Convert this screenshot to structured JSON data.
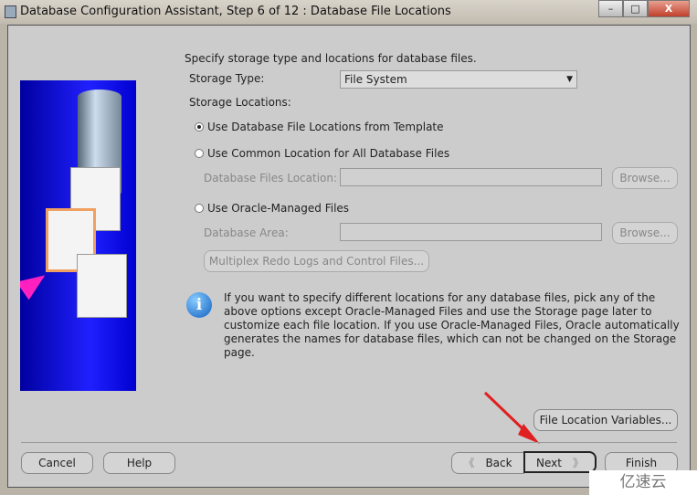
{
  "window": {
    "title": "Database Configuration Assistant, Step 6 of 12 : Database File Locations",
    "minimize": "–",
    "maximize": "□",
    "close": "X"
  },
  "intro": "Specify storage type and locations for database files.",
  "storage_type_label": "Storage Type:",
  "storage_type_value": "File System",
  "storage_locations_label": "Storage Locations:",
  "options": [
    {
      "label": "Use Database File Locations from Template",
      "selected": true
    },
    {
      "label": "Use Common Location for All Database Files",
      "selected": false
    },
    {
      "label": "Use Oracle-Managed Files",
      "selected": false
    }
  ],
  "db_files_location_label": "Database Files Location:",
  "db_files_location_value": "",
  "db_area_label": "Database Area:",
  "db_area_value": "",
  "browse": "Browse...",
  "multiplex": "Multiplex Redo Logs and Control Files...",
  "info": "If you want to specify different locations for any database files, pick any of the above options except Oracle-Managed Files and use the Storage page later to customize each file location. If you use Oracle-Managed Files, Oracle automatically generates the names for database files, which can not be changed on the Storage page.",
  "file_location_variables": "File Location Variables...",
  "buttons": {
    "cancel": "Cancel",
    "help": "Help",
    "back": "Back",
    "next": "Next",
    "finish": "Finish"
  },
  "watermark": "亿速云"
}
